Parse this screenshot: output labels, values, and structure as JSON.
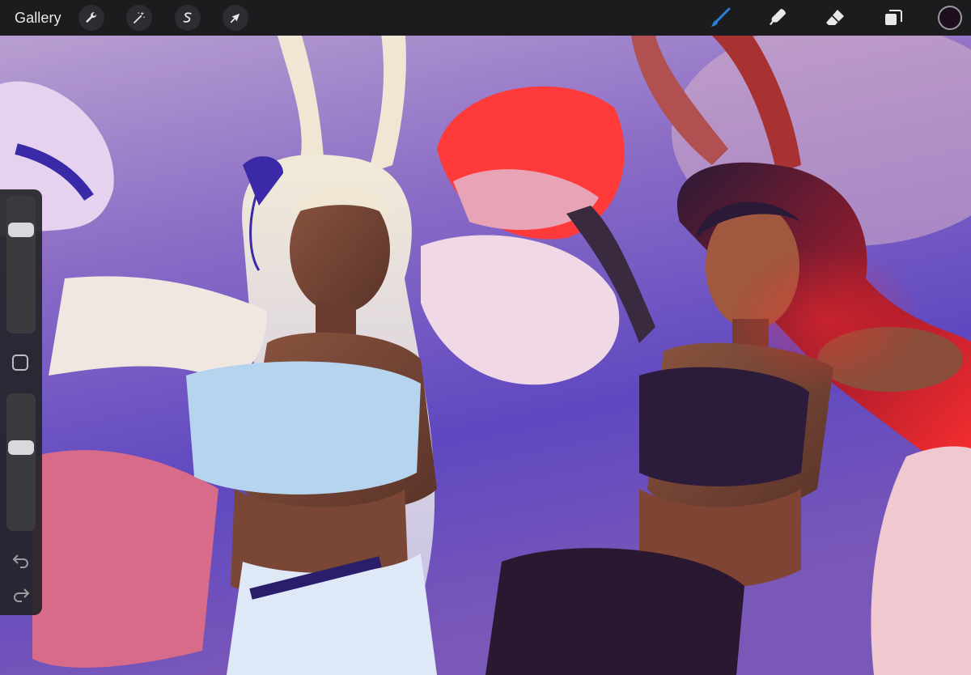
{
  "toolbar": {
    "gallery_label": "Gallery",
    "left_tools": [
      {
        "name": "actions",
        "icon": "wrench-icon"
      },
      {
        "name": "adjustments",
        "icon": "magic-wand-icon"
      },
      {
        "name": "selection",
        "icon": "selection-s-icon"
      },
      {
        "name": "transform",
        "icon": "arrow-cursor-icon"
      }
    ],
    "right_tools": [
      {
        "name": "brush",
        "icon": "brush-icon",
        "active": true
      },
      {
        "name": "smudge",
        "icon": "smudge-finger-icon",
        "active": false
      },
      {
        "name": "eraser",
        "icon": "eraser-icon",
        "active": false
      },
      {
        "name": "layers",
        "icon": "layers-icon",
        "active": false
      }
    ],
    "current_color": "#1e0f1c",
    "active_color": "#2a7fd8"
  },
  "sidebar": {
    "brush_size_level": 0.78,
    "opacity_level": 0.62,
    "modifier_icon": "square-modifier-icon",
    "undo_icon": "undo-icon",
    "redo_icon": "redo-icon"
  },
  "canvas": {
    "artwork": "painting-of-two-bunny-eared-cheerleaders"
  }
}
